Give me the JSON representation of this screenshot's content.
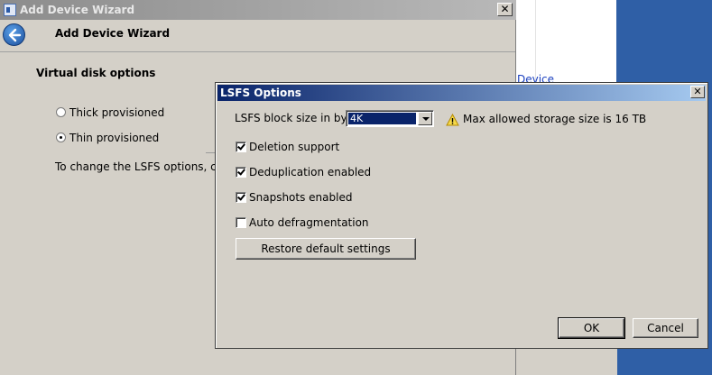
{
  "background_window": {
    "partial_text": "Device"
  },
  "wizard": {
    "title": "Add Device Wizard",
    "close_glyph": "✕",
    "header_title": "Add Device Wizard",
    "section_title": "Virtual disk options",
    "radios": [
      {
        "label": "Thick provisioned",
        "checked": false
      },
      {
        "label": "Thin provisioned",
        "checked": true
      }
    ],
    "hint": "To change the LSFS options, click \"Op"
  },
  "lsfs_dialog": {
    "title": "LSFS Options",
    "close_glyph": "✕",
    "block_size_label": "LSFS block size in bytes:",
    "block_size_value": "4K",
    "max_storage_text": "Max allowed storage size is 16 TB",
    "checkboxes": [
      {
        "label": "Deletion support",
        "checked": true
      },
      {
        "label": "Deduplication enabled",
        "checked": true
      },
      {
        "label": "Snapshots enabled",
        "checked": true
      },
      {
        "label": "Auto defragmentation",
        "checked": false
      }
    ],
    "restore_label": "Restore default settings",
    "ok_label": "OK",
    "cancel_label": "Cancel"
  },
  "colors": {
    "active_titlebar": "#0a246a",
    "inactive_titlebar": "#8c8c8c",
    "face": "#d4d0c8",
    "desktop": "#2f5fa6"
  },
  "icons": {
    "back": "back-arrow-icon",
    "warning": "warning-icon",
    "dropdown": "chevron-down-icon"
  }
}
